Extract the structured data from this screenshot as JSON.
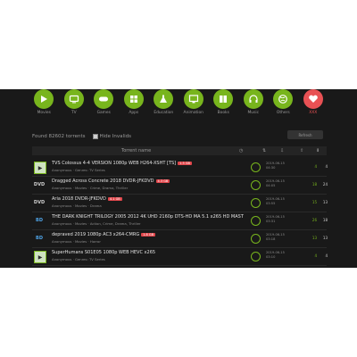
{
  "categories": [
    {
      "label": "Movies",
      "icon": "play-icon"
    },
    {
      "label": "TV",
      "icon": "tv-icon"
    },
    {
      "label": "Games",
      "icon": "gamepad-icon"
    },
    {
      "label": "Apps",
      "icon": "windows-icon"
    },
    {
      "label": "Education",
      "icon": "flask-icon"
    },
    {
      "label": "Animation",
      "icon": "monitor-icon"
    },
    {
      "label": "Books",
      "icon": "book-icon"
    },
    {
      "label": "Music",
      "icon": "headphones-icon"
    },
    {
      "label": "Others",
      "icon": "globe-icon"
    },
    {
      "label": "XXX",
      "icon": "heart-icon"
    }
  ],
  "info": {
    "found": "Found 82602 torrents",
    "hide": "Hide Invalids"
  },
  "button_right": "Refresh",
  "table": {
    "header": "Torrent name"
  },
  "rows": [
    {
      "title": "TVS Colossus 4-4 VERSION 1080p WEB H264-XSHT [TS]",
      "meta": "Anonymous · Genres: TV Series",
      "type": "tv",
      "tag1": "1.5 GB",
      "tag2": "",
      "date": "2019-06-15 04:30",
      "seed": "4",
      "leech": "4"
    },
    {
      "title": "Dragged Across Concrete 2018 DVDR-JFKDVD",
      "meta": "Anonymous · Movies · Crime, Drama, Thriller",
      "type": "dvd",
      "tag1": "4.3 GB",
      "tag2": "",
      "date": "2019-06-15 04:05",
      "seed": "18",
      "leech": "24"
    },
    {
      "title": "Aria 2018 DVDR-JFKDVD",
      "meta": "Anonymous · Movies · Drama",
      "type": "dvd",
      "tag1": "4.1 GB",
      "tag2": "",
      "date": "2019-06-15 03:55",
      "seed": "15",
      "leech": "13"
    },
    {
      "title": "THE DARK KNIGHT TRILOGY 2005 2012 4K UHD 2160p DTS-HD MA 5.1 x265 HD MASTER HDR",
      "meta": "Anonymous · Movies · Action, Crime, Drama, Thriller",
      "type": "br",
      "tag1": "44.8 GB",
      "tag2": "",
      "date": "2019-06-15 03:31",
      "seed": "26",
      "leech": "18"
    },
    {
      "title": "depraved 2019 1080p AC3 x264-CMRG",
      "meta": "Anonymous · Movies · Horror",
      "type": "br",
      "tag1": "1.8 GB",
      "tag2": "",
      "date": "2019-06-15 03:18",
      "seed": "13",
      "leech": "13"
    },
    {
      "title": "SuperHumans S01E05 1080p WEB HEVC x265",
      "meta": "Anonymous · Genres: TV Series",
      "type": "tv",
      "tag1": "",
      "tag2": "",
      "date": "2019-06-15 03:10",
      "seed": "4",
      "leech": "4"
    }
  ]
}
